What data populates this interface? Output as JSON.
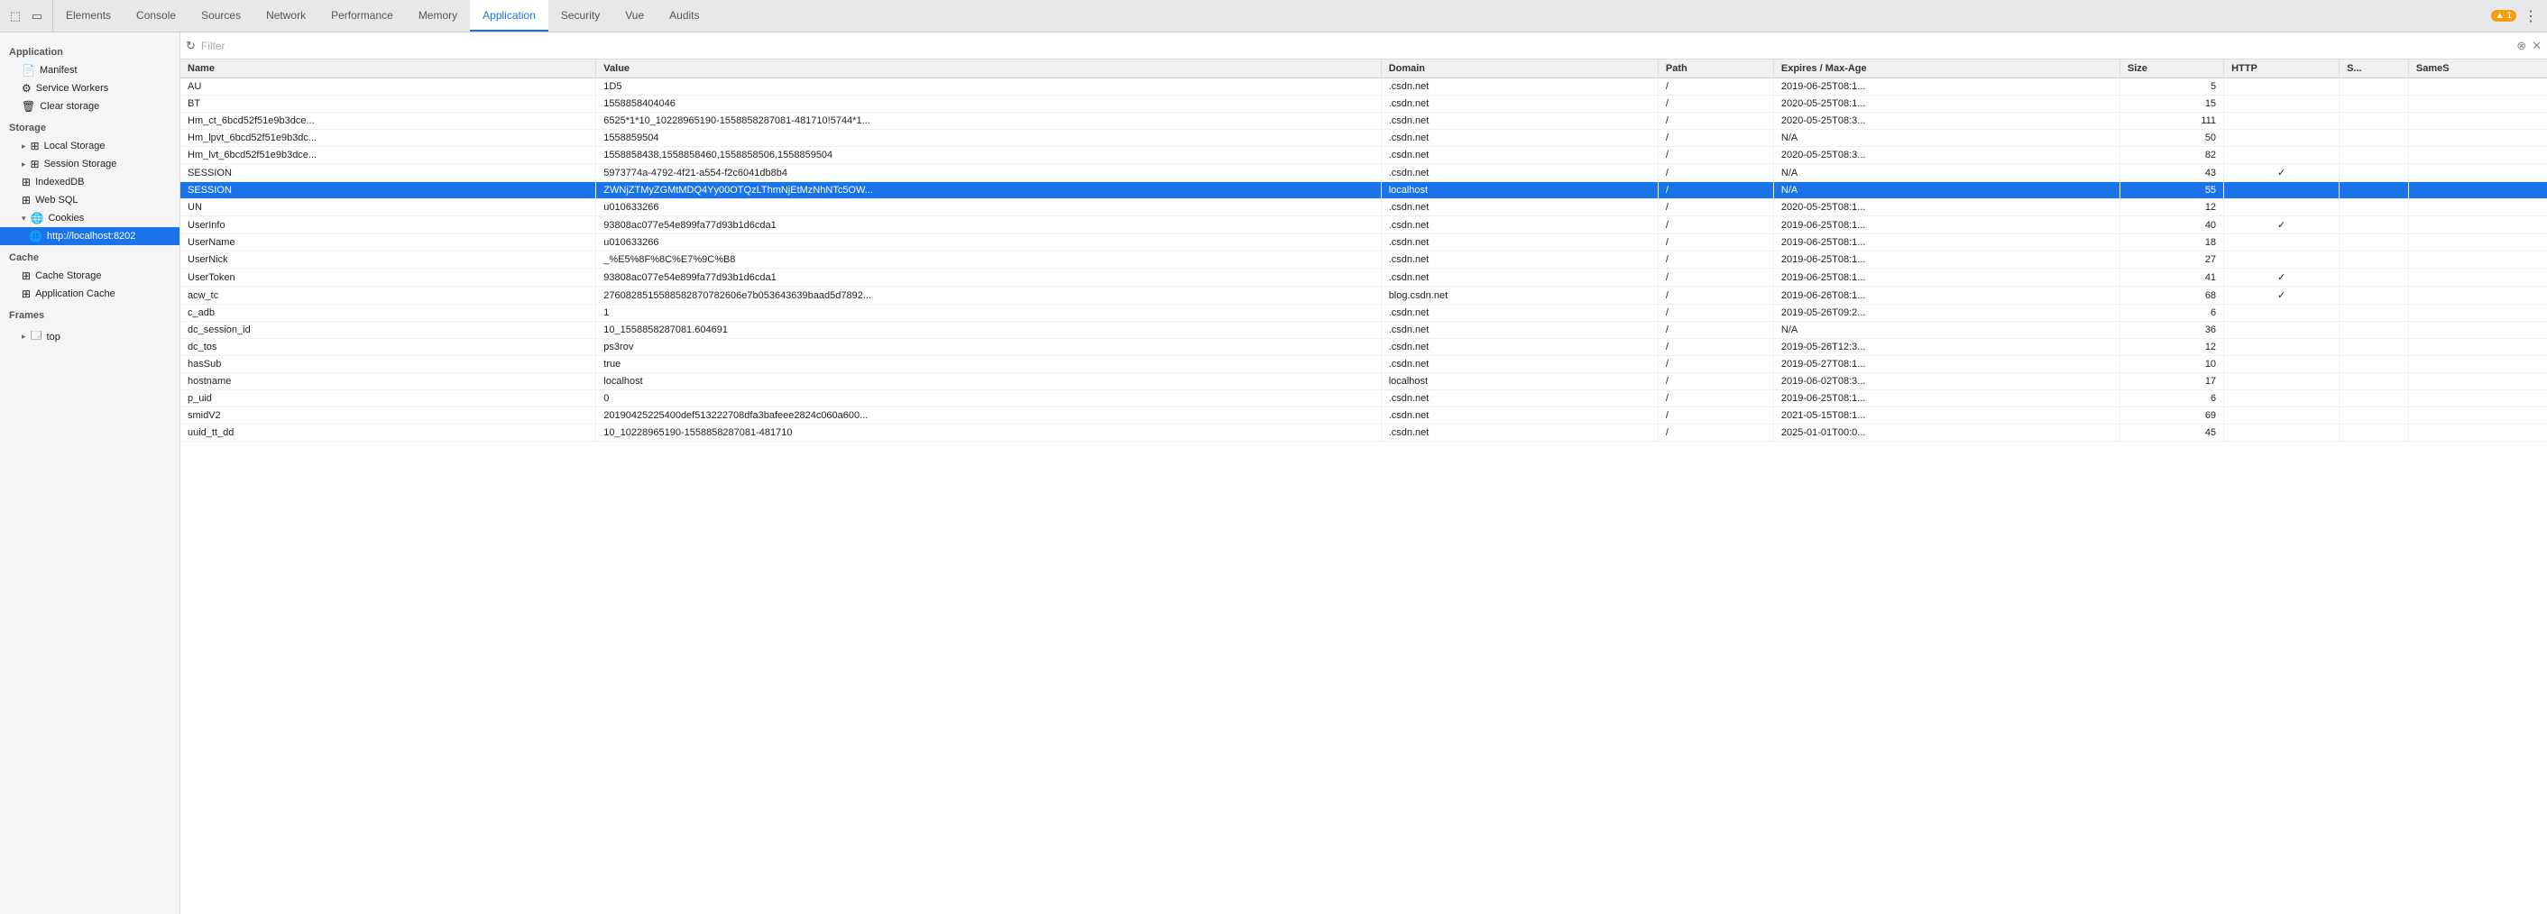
{
  "topbar": {
    "icons": [
      "cursor-icon",
      "layout-icon"
    ],
    "tabs": [
      {
        "id": "elements",
        "label": "Elements"
      },
      {
        "id": "console",
        "label": "Console"
      },
      {
        "id": "sources",
        "label": "Sources"
      },
      {
        "id": "network",
        "label": "Network"
      },
      {
        "id": "performance",
        "label": "Performance"
      },
      {
        "id": "memory",
        "label": "Memory"
      },
      {
        "id": "application",
        "label": "Application",
        "active": true
      },
      {
        "id": "security",
        "label": "Security"
      },
      {
        "id": "vue",
        "label": "Vue"
      },
      {
        "id": "audits",
        "label": "Audits"
      }
    ],
    "warning": "▲ 1",
    "menu": "⋮"
  },
  "sidebar": {
    "sections": [
      {
        "label": "Application",
        "items": [
          {
            "id": "manifest",
            "icon": "📄",
            "label": "Manifest",
            "indent": 1
          },
          {
            "id": "service-workers",
            "icon": "⚙",
            "label": "Service Workers",
            "indent": 1
          },
          {
            "id": "clear-storage",
            "icon": "🗑",
            "label": "Clear storage",
            "indent": 1
          }
        ]
      },
      {
        "label": "Storage",
        "items": [
          {
            "id": "local-storage",
            "icon": "⊞",
            "label": "Local Storage",
            "indent": 1,
            "expandable": true
          },
          {
            "id": "session-storage",
            "icon": "⊞",
            "label": "Session Storage",
            "indent": 1,
            "expandable": true
          },
          {
            "id": "indexeddb",
            "icon": "⊞",
            "label": "IndexedDB",
            "indent": 1
          },
          {
            "id": "web-sql",
            "icon": "⊞",
            "label": "Web SQL",
            "indent": 1
          },
          {
            "id": "cookies",
            "icon": "🌐",
            "label": "Cookies",
            "indent": 1,
            "expandable": true,
            "expanded": true
          },
          {
            "id": "localhost-8202",
            "icon": "🌐",
            "label": "http://localhost:8202",
            "indent": 2,
            "selected": true
          }
        ]
      },
      {
        "label": "Cache",
        "items": [
          {
            "id": "cache-storage",
            "icon": "⊞",
            "label": "Cache Storage",
            "indent": 1
          },
          {
            "id": "application-cache",
            "icon": "⊞",
            "label": "Application Cache",
            "indent": 1
          }
        ]
      },
      {
        "label": "Frames",
        "items": [
          {
            "id": "top",
            "icon": "🗔",
            "label": "top",
            "indent": 1,
            "expandable": true
          }
        ]
      }
    ]
  },
  "filter": {
    "placeholder": "Filter",
    "value": ""
  },
  "table": {
    "columns": [
      {
        "id": "name",
        "label": "Name"
      },
      {
        "id": "value",
        "label": "Value"
      },
      {
        "id": "domain",
        "label": "Domain"
      },
      {
        "id": "path",
        "label": "Path"
      },
      {
        "id": "expires",
        "label": "Expires / Max-Age"
      },
      {
        "id": "size",
        "label": "Size"
      },
      {
        "id": "http",
        "label": "HTTP"
      },
      {
        "id": "s",
        "label": "S..."
      },
      {
        "id": "sames",
        "label": "SameS"
      }
    ],
    "rows": [
      {
        "name": "AU",
        "value": "1D5",
        "domain": ".csdn.net",
        "path": "/",
        "expires": "2019-06-25T08:1...",
        "size": "5",
        "http": "",
        "s": "",
        "sames": ""
      },
      {
        "name": "BT",
        "value": "1558858404046",
        "domain": ".csdn.net",
        "path": "/",
        "expires": "2020-05-25T08:1...",
        "size": "15",
        "http": "",
        "s": "",
        "sames": ""
      },
      {
        "name": "Hm_ct_6bcd52f51e9b3dce...",
        "value": "6525*1*10_10228965190-1558858287081-481710!5744*1...",
        "domain": ".csdn.net",
        "path": "/",
        "expires": "2020-05-25T08:3...",
        "size": "111",
        "http": "",
        "s": "",
        "sames": ""
      },
      {
        "name": "Hm_lpvt_6bcd52f51e9b3dc...",
        "value": "1558859504",
        "domain": ".csdn.net",
        "path": "/",
        "expires": "N/A",
        "size": "50",
        "http": "",
        "s": "",
        "sames": ""
      },
      {
        "name": "Hm_lvt_6bcd52f51e9b3dce...",
        "value": "1558858438,1558858460,1558858506,1558859504",
        "domain": ".csdn.net",
        "path": "/",
        "expires": "2020-05-25T08:3...",
        "size": "82",
        "http": "",
        "s": "",
        "sames": ""
      },
      {
        "name": "SESSION",
        "value": "5973774a-4792-4f21-a554-f2c6041db8b4",
        "domain": ".csdn.net",
        "path": "/",
        "expires": "N/A",
        "size": "43",
        "http": "✓",
        "s": "",
        "sames": ""
      },
      {
        "name": "SESSION",
        "value": "ZWNjZTMyZGMtMDQ4Yy00OTQzLThmNjEtMzNhNTc5OW...",
        "domain": "localhost",
        "path": "/",
        "expires": "N/A",
        "size": "55",
        "http": "",
        "s": "",
        "sames": "",
        "selected": true
      },
      {
        "name": "UN",
        "value": "u010633266",
        "domain": ".csdn.net",
        "path": "/",
        "expires": "2020-05-25T08:1...",
        "size": "12",
        "http": "",
        "s": "",
        "sames": ""
      },
      {
        "name": "UserInfo",
        "value": "93808ac077e54e899fa77d93b1d6cda1",
        "domain": ".csdn.net",
        "path": "/",
        "expires": "2019-06-25T08:1...",
        "size": "40",
        "http": "✓",
        "s": "",
        "sames": ""
      },
      {
        "name": "UserName",
        "value": "u010633266",
        "domain": ".csdn.net",
        "path": "/",
        "expires": "2019-06-25T08:1...",
        "size": "18",
        "http": "",
        "s": "",
        "sames": ""
      },
      {
        "name": "UserNick",
        "value": "_%E5%8F%8C%E7%9C%B8",
        "domain": ".csdn.net",
        "path": "/",
        "expires": "2019-06-25T08:1...",
        "size": "27",
        "http": "",
        "s": "",
        "sames": ""
      },
      {
        "name": "UserToken",
        "value": "93808ac077e54e899fa77d93b1d6cda1",
        "domain": ".csdn.net",
        "path": "/",
        "expires": "2019-06-25T08:1...",
        "size": "41",
        "http": "✓",
        "s": "",
        "sames": ""
      },
      {
        "name": "acw_tc",
        "value": "2760828515588582870782606e7b053643639baad5d7892...",
        "domain": "blog.csdn.net",
        "path": "/",
        "expires": "2019-06-26T08:1...",
        "size": "68",
        "http": "✓",
        "s": "",
        "sames": ""
      },
      {
        "name": "c_adb",
        "value": "1",
        "domain": ".csdn.net",
        "path": "/",
        "expires": "2019-05-26T09:2...",
        "size": "6",
        "http": "",
        "s": "",
        "sames": ""
      },
      {
        "name": "dc_session_id",
        "value": "10_1558858287081.604691",
        "domain": ".csdn.net",
        "path": "/",
        "expires": "N/A",
        "size": "36",
        "http": "",
        "s": "",
        "sames": ""
      },
      {
        "name": "dc_tos",
        "value": "ps3rov",
        "domain": ".csdn.net",
        "path": "/",
        "expires": "2019-05-26T12:3...",
        "size": "12",
        "http": "",
        "s": "",
        "sames": ""
      },
      {
        "name": "hasSub",
        "value": "true",
        "domain": ".csdn.net",
        "path": "/",
        "expires": "2019-05-27T08:1...",
        "size": "10",
        "http": "",
        "s": "",
        "sames": ""
      },
      {
        "name": "hostname",
        "value": "localhost",
        "domain": "localhost",
        "path": "/",
        "expires": "2019-06-02T08:3...",
        "size": "17",
        "http": "",
        "s": "",
        "sames": ""
      },
      {
        "name": "p_uid",
        "value": "0",
        "domain": ".csdn.net",
        "path": "/",
        "expires": "2019-06-25T08:1...",
        "size": "6",
        "http": "",
        "s": "",
        "sames": ""
      },
      {
        "name": "smidV2",
        "value": "20190425225400def513222708dfa3bafeee2824c060a600...",
        "domain": ".csdn.net",
        "path": "/",
        "expires": "2021-05-15T08:1...",
        "size": "69",
        "http": "",
        "s": "",
        "sames": ""
      },
      {
        "name": "uuid_tt_dd",
        "value": "10_10228965190-1558858287081-481710",
        "domain": ".csdn.net",
        "path": "/",
        "expires": "2025-01-01T00:0...",
        "size": "45",
        "http": "",
        "s": "",
        "sames": ""
      }
    ]
  }
}
